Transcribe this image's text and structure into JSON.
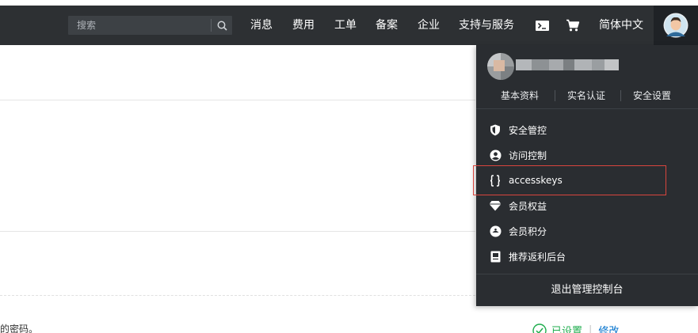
{
  "topbar": {
    "search": {
      "placeholder": "搜索"
    },
    "nav": [
      {
        "label": "消息"
      },
      {
        "label": "费用"
      },
      {
        "label": "工单"
      },
      {
        "label": "备案"
      },
      {
        "label": "企业"
      },
      {
        "label": "支持与服务"
      }
    ],
    "language": "简体中文"
  },
  "dropdown": {
    "profile_links": [
      "基本资料",
      "实名认证",
      "安全设置"
    ],
    "menu": [
      {
        "label": "安全管控",
        "icon": "shield-icon"
      },
      {
        "label": "访问控制",
        "icon": "user-circle-icon"
      },
      {
        "label": "accesskeys",
        "icon": "braces-icon"
      },
      {
        "label": "会员权益",
        "icon": "diamond-icon"
      },
      {
        "label": "会员积分",
        "icon": "points-icon"
      },
      {
        "label": "推荐返利后台",
        "icon": "document-icon"
      }
    ],
    "logout": "退出管理控制台"
  },
  "content": {
    "password_text": "的密码。",
    "status": "已设置",
    "modify": "修改"
  },
  "colors": {
    "topbar": "#2d3033",
    "dropdown": "#2a2d31",
    "highlight": "#d9453d",
    "status_ok": "#1fad4e",
    "link": "#0070cc"
  }
}
